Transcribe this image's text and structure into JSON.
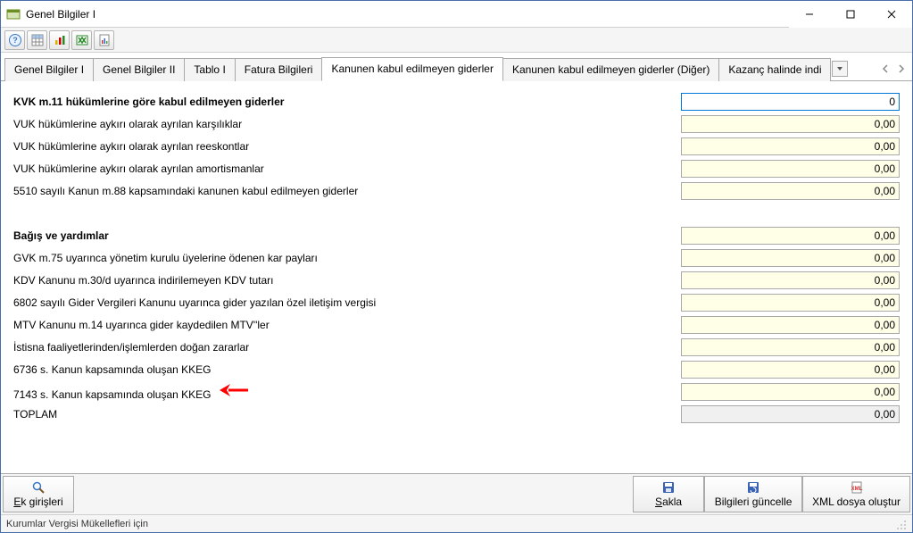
{
  "window": {
    "title": "Genel Bilgiler I"
  },
  "tabs": {
    "items": [
      "Genel Bilgiler I",
      "Genel Bilgiler II",
      "Tablo I",
      "Fatura Bilgileri",
      "Kanunen kabul edilmeyen giderler",
      "Kanunen kabul edilmeyen giderler (Diğer)",
      "Kazanç halinde indi"
    ],
    "active_index": 4
  },
  "form": {
    "rows": [
      {
        "label": "KVK m.11 hükümlerine göre kabul edilmeyen giderler",
        "value": "0",
        "bold": true,
        "focused": true
      },
      {
        "label": "VUK hükümlerine aykırı olarak ayrılan karşılıklar",
        "value": "0,00"
      },
      {
        "label": "VUK hükümlerine aykırı olarak ayrılan reeskontlar",
        "value": "0,00"
      },
      {
        "label": "VUK hükümlerine aykırı olarak ayrılan amortismanlar",
        "value": "0,00"
      },
      {
        "label": "5510 sayılı Kanun m.88 kapsamındaki kanunen kabul edilmeyen giderler",
        "value": "0,00"
      },
      {
        "gap": true
      },
      {
        "label": "Bağış ve yardımlar",
        "value": "0,00",
        "bold": true
      },
      {
        "label": "GVK m.75 uyarınca yönetim kurulu üyelerine ödenen kar payları",
        "value": "0,00"
      },
      {
        "label": "KDV Kanunu m.30/d uyarınca indirilemeyen KDV tutarı",
        "value": "0,00"
      },
      {
        "label": "6802 sayılı Gider Vergileri Kanunu uyarınca gider yazılan özel iletişim vergisi",
        "value": "0,00"
      },
      {
        "label": "MTV Kanunu m.14 uyarınca gider kaydedilen MTV''ler",
        "value": "0,00"
      },
      {
        "label": "İstisna faaliyetlerinden/işlemlerden doğan zararlar",
        "value": "0,00"
      },
      {
        "label": "6736 s. Kanun kapsamında oluşan KKEG",
        "value": "0,00"
      },
      {
        "label": "7143 s. Kanun kapsamında oluşan KKEG",
        "value": "0,00",
        "arrow": true
      },
      {
        "label": "TOPLAM",
        "value": "0,00",
        "readonly": true
      }
    ]
  },
  "buttons": {
    "ek_girisleri": "Ek girişleri",
    "sakla": "Sakla",
    "bilgileri_guncelle": "Bilgileri güncelle",
    "xml_dosya_olustur": "XML dosya oluştur"
  },
  "statusbar": {
    "text": "Kurumlar Vergisi Mükellefleri için"
  }
}
